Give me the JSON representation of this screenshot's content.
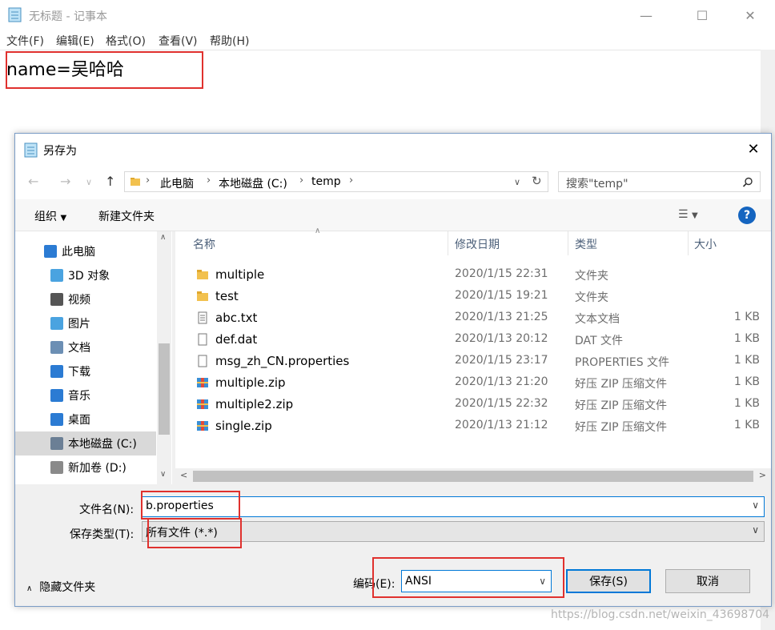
{
  "notepad": {
    "title": "无标题 - 记事本",
    "menu": [
      "文件(F)",
      "编辑(E)",
      "格式(O)",
      "查看(V)",
      "帮助(H)"
    ],
    "content": "name=吴哈哈"
  },
  "dialog": {
    "title": "另存为",
    "close": "✕",
    "address": {
      "segments": [
        "此电脑",
        "本地磁盘 (C:)",
        "temp"
      ]
    },
    "search_placeholder": "搜索\"temp\"",
    "toolbar": {
      "organize": "组织",
      "new_folder": "新建文件夹",
      "help": "?"
    },
    "nav_items": [
      {
        "label": "此电脑",
        "icon": "computer-icon"
      },
      {
        "label": "3D 对象",
        "icon": "3d-objects-icon"
      },
      {
        "label": "视频",
        "icon": "video-icon"
      },
      {
        "label": "图片",
        "icon": "pictures-icon"
      },
      {
        "label": "文档",
        "icon": "documents-icon"
      },
      {
        "label": "下载",
        "icon": "downloads-icon"
      },
      {
        "label": "音乐",
        "icon": "music-icon"
      },
      {
        "label": "桌面",
        "icon": "desktop-icon"
      },
      {
        "label": "本地磁盘 (C:)",
        "icon": "local-disk-icon",
        "selected": true
      },
      {
        "label": "新加卷 (D:)",
        "icon": "drive-icon"
      }
    ],
    "columns": {
      "name": "名称",
      "date": "修改日期",
      "type": "类型",
      "size": "大小"
    },
    "files": [
      {
        "name": "multiple",
        "date": "2020/1/15 22:31",
        "type": "文件夹",
        "size": "",
        "icon": "folder-icon"
      },
      {
        "name": "test",
        "date": "2020/1/15 19:21",
        "type": "文件夹",
        "size": "",
        "icon": "folder-icon"
      },
      {
        "name": "abc.txt",
        "date": "2020/1/13 21:25",
        "type": "文本文档",
        "size": "1 KB",
        "icon": "text-file-icon"
      },
      {
        "name": "def.dat",
        "date": "2020/1/13 20:12",
        "type": "DAT 文件",
        "size": "1 KB",
        "icon": "file-icon"
      },
      {
        "name": "msg_zh_CN.properties",
        "date": "2020/1/15 23:17",
        "type": "PROPERTIES 文件",
        "size": "1 KB",
        "icon": "file-icon"
      },
      {
        "name": "multiple.zip",
        "date": "2020/1/13 21:20",
        "type": "好压 ZIP 压缩文件",
        "size": "1 KB",
        "icon": "zip-icon"
      },
      {
        "name": "multiple2.zip",
        "date": "2020/1/15 22:32",
        "type": "好压 ZIP 压缩文件",
        "size": "1 KB",
        "icon": "zip-icon"
      },
      {
        "name": "single.zip",
        "date": "2020/1/13 21:12",
        "type": "好压 ZIP 压缩文件",
        "size": "1 KB",
        "icon": "zip-icon"
      }
    ],
    "filename_label": "文件名(N):",
    "filename_value": "b.properties",
    "filetype_label": "保存类型(T):",
    "filetype_value": "所有文件  (*.*)",
    "hide_folders": "隐藏文件夹",
    "encoding_label": "编码(E):",
    "encoding_value": "ANSI",
    "save_label": "保存(S)",
    "cancel_label": "取消"
  },
  "watermark": "https://blog.csdn.net/weixin_43698704",
  "colors": {
    "highlight_box": "#e0312e",
    "accent": "#0078d7"
  }
}
